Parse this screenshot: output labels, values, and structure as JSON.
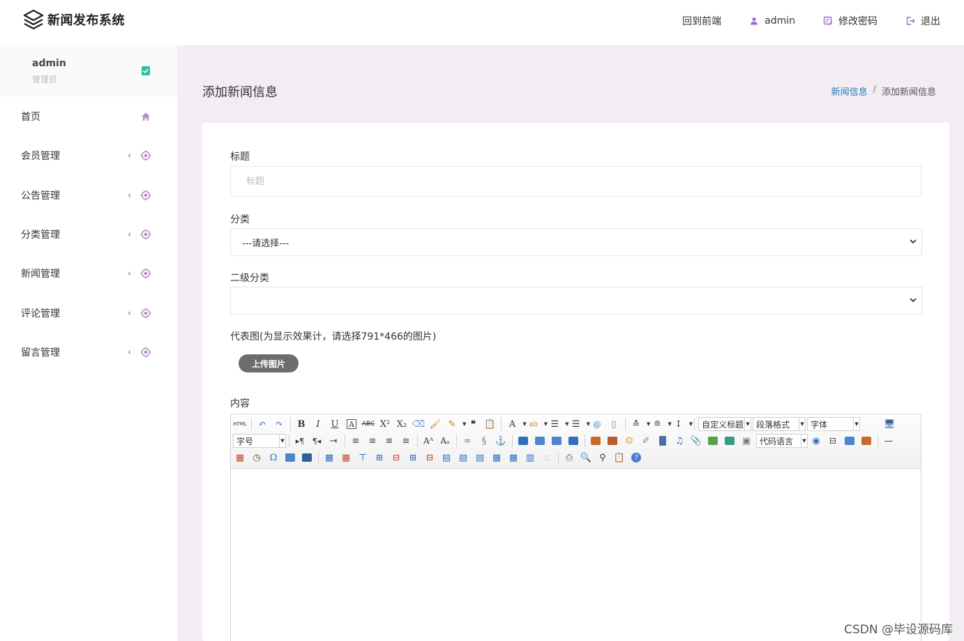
{
  "header": {
    "brand": "新闻发布系统",
    "nav": [
      {
        "label": "回到前端",
        "icon": "none"
      },
      {
        "label": "admin",
        "icon": "user-icon"
      },
      {
        "label": "修改密码",
        "icon": "edit-password-icon"
      },
      {
        "label": "退出",
        "icon": "logout-icon"
      }
    ]
  },
  "sidebar": {
    "user_name": "admin",
    "user_role": "管理员",
    "items": [
      {
        "label": "首页",
        "icon": "home-icon"
      },
      {
        "label": "会员管理",
        "icon": "target-icon"
      },
      {
        "label": "公告管理",
        "icon": "target-icon"
      },
      {
        "label": "分类管理",
        "icon": "target-icon"
      },
      {
        "label": "新闻管理",
        "icon": "target-icon"
      },
      {
        "label": "评论管理",
        "icon": "target-icon"
      },
      {
        "label": "留言管理",
        "icon": "target-icon"
      }
    ],
    "chevron": "‹"
  },
  "main": {
    "page_title": "添加新闻信息",
    "breadcrumb": {
      "parent": "新闻信息",
      "separator": "/",
      "current": "添加新闻信息"
    },
    "form": {
      "title_label": "标题",
      "title_placeholder": "标题",
      "category_label": "分类",
      "category_value": "---请选择---",
      "subcategory_label": "二级分类",
      "subcategory_value": "",
      "image_label": "代表图(为显示效果计，请选择791*466的图片)",
      "upload_button": "上传图片",
      "content_label": "内容"
    },
    "editor": {
      "html_button": "HTML",
      "combo_custom_title": "自定义标题",
      "combo_paragraph": "段落格式",
      "combo_font": "字体",
      "combo_font_size": "字号",
      "combo_code_lang": "代码语言"
    }
  },
  "watermark": "CSDN @毕设源码库",
  "colors": {
    "background": "#f1edf3",
    "accent_purple": "#9b6fd0",
    "breadcrumb_link": "#2a7ab8",
    "check_green": "#2bbf9f"
  }
}
